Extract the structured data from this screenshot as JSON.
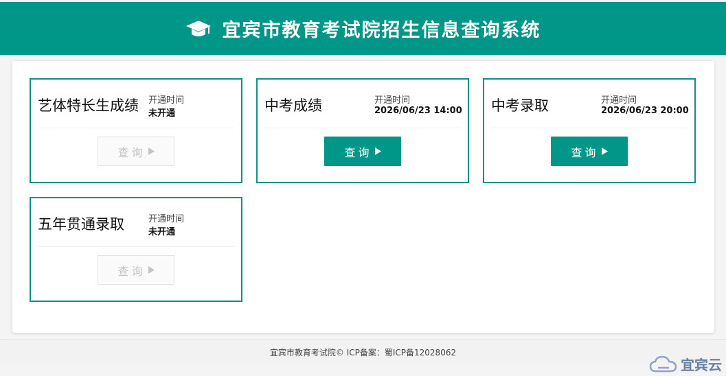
{
  "header": {
    "title": "宜宾市教育考试院招生信息查询系统",
    "icon": "graduation-cap-icon"
  },
  "cards": [
    {
      "name": "艺体特长生成绩",
      "open_label": "开通时间",
      "open_value": "未开通",
      "button_label": "查询",
      "enabled": false
    },
    {
      "name": "中考成绩",
      "open_label": "开通时间",
      "open_value": "2026/06/23 14:00",
      "button_label": "查询",
      "enabled": true
    },
    {
      "name": "中考录取",
      "open_label": "开通时间",
      "open_value": "2026/06/23 20:00",
      "button_label": "查询",
      "enabled": true
    },
    {
      "name": "五年贯通录取",
      "open_label": "开通时间",
      "open_value": "未开通",
      "button_label": "查询",
      "enabled": false
    }
  ],
  "footer": {
    "text": "宜宾市教育考试院© ICP备案：蜀ICP备12028062"
  },
  "watermark": {
    "text": "宜宾云"
  },
  "colors": {
    "brand": "#009688",
    "card_border": "#0f8f86"
  }
}
